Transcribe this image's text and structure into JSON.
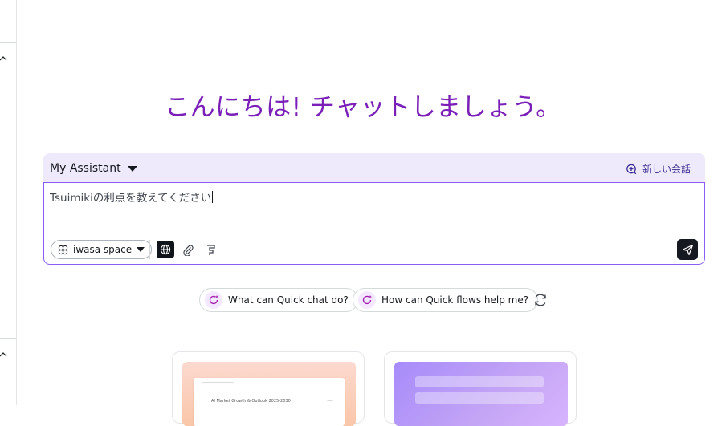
{
  "greeting": "こんにちは! チャットしましょう。",
  "composer": {
    "assistant_name": "My Assistant",
    "new_chat_label": "新しい会話",
    "prompt_value": "Tsuimikiの利点を教えてください",
    "space_name": "iwasa space"
  },
  "suggestions": [
    {
      "label": "What can Quick chat do?"
    },
    {
      "label": "How can Quick flows help me?"
    }
  ],
  "cards": [
    {
      "thumb_text": "AI Market Growth & Outlook 2025-2030"
    },
    {
      "thumb_text": ""
    }
  ],
  "colors": {
    "greeting": "#7a1fb8",
    "header_bg": "#efe9fc",
    "composer_border": "#8b5cf6",
    "send_bg": "#16191f"
  },
  "icons": {
    "new_chat": "chat-plus-icon",
    "space": "spaces-icon",
    "web": "globe-icon",
    "attach": "paperclip-icon",
    "flow": "flow-icon",
    "send": "send-icon",
    "suggestion": "sparkle-chat-icon",
    "refresh": "refresh-icon"
  }
}
